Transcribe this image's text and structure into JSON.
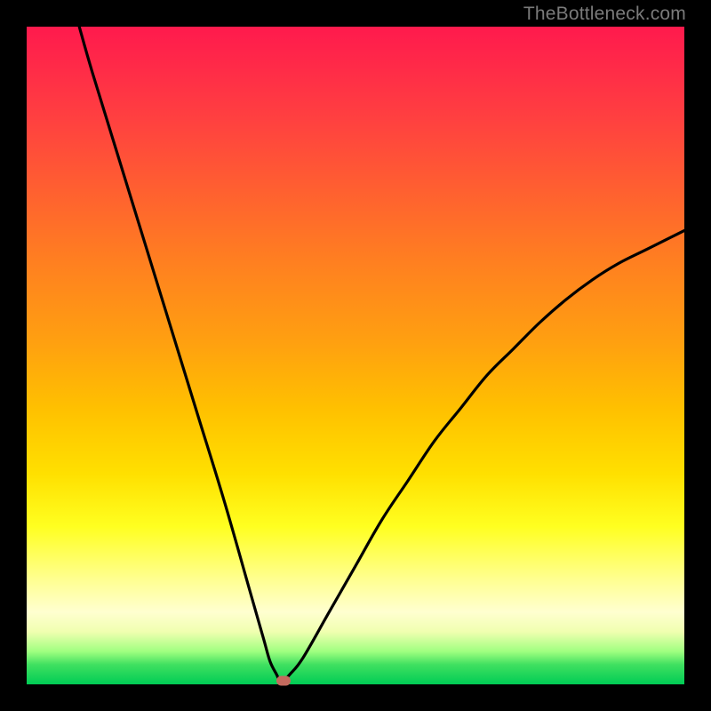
{
  "watermark": "TheBottleneck.com",
  "chart_data": {
    "type": "line",
    "title": "",
    "xlabel": "",
    "ylabel": "",
    "xlim": [
      0,
      100
    ],
    "ylim": [
      0,
      100
    ],
    "grid": false,
    "series": [
      {
        "name": "bottleneck-curve",
        "x": [
          8,
          10,
          14,
          18,
          22,
          26,
          30,
          34,
          36,
          37,
          38,
          38.5,
          39,
          40,
          42,
          46,
          50,
          54,
          58,
          62,
          66,
          70,
          74,
          78,
          82,
          86,
          90,
          94,
          98,
          100
        ],
        "values": [
          100,
          93,
          80,
          67,
          54,
          41,
          28,
          14,
          7,
          3.5,
          1.5,
          0.5,
          0.5,
          1.5,
          4,
          11,
          18,
          25,
          31,
          37,
          42,
          47,
          51,
          55,
          58.5,
          61.5,
          64,
          66,
          68,
          69
        ]
      }
    ],
    "marker": {
      "x": 39,
      "y": 0.5,
      "color": "#c46a5e"
    },
    "colors": {
      "gradient_top": "#ff1a4d",
      "gradient_bottom": "#00cc55",
      "curve": "#000000",
      "frame": "#000000"
    }
  }
}
